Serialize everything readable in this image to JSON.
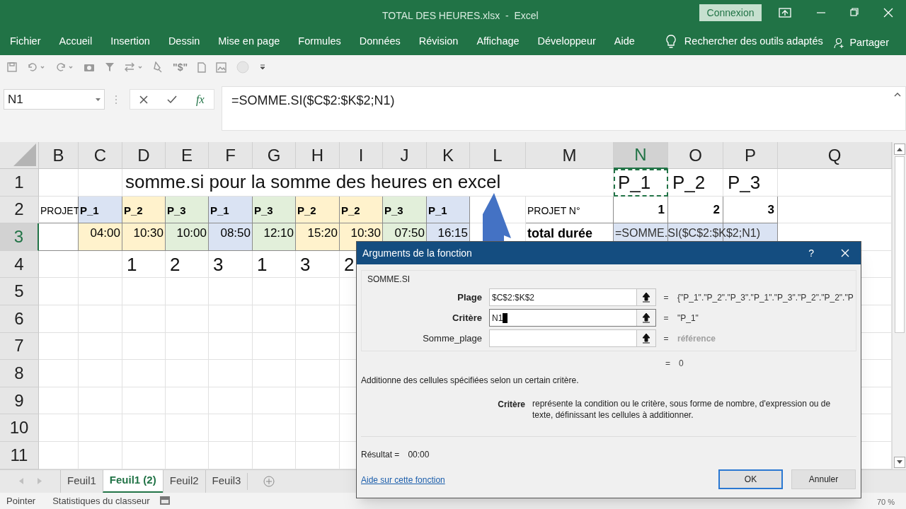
{
  "window": {
    "title": "TOTAL DES HEURES.xlsx  -  Excel",
    "account_button": "Connexion"
  },
  "ribbon_tabs": [
    "Fichier",
    "Accueil",
    "Insertion",
    "Dessin",
    "Mise en page",
    "Formules",
    "Données",
    "Révision",
    "Affichage",
    "Développeur",
    "Aide"
  ],
  "tell_me": "Rechercher des outils adaptés",
  "share": "Partager",
  "quick_access_text": "\"$\"",
  "formula_bar": {
    "name_box": "N1",
    "function_symbol": "fx",
    "formula": "=SOMME.SI($C$2:$K$2;N1)"
  },
  "sheet": {
    "columns": [
      {
        "label": "B",
        "selected": false
      },
      {
        "label": "C",
        "selected": false
      },
      {
        "label": "D",
        "selected": false
      },
      {
        "label": "E",
        "selected": false
      },
      {
        "label": "F",
        "selected": false
      },
      {
        "label": "G",
        "selected": false
      },
      {
        "label": "H",
        "selected": false
      },
      {
        "label": "I",
        "selected": false
      },
      {
        "label": "J",
        "selected": false
      },
      {
        "label": "K",
        "selected": false
      },
      {
        "label": "L",
        "selected": false
      },
      {
        "label": "M",
        "selected": false
      },
      {
        "label": "N",
        "selected": true
      },
      {
        "label": "O",
        "selected": false
      },
      {
        "label": "P",
        "selected": false
      },
      {
        "label": "Q",
        "selected": false
      }
    ],
    "rows": [
      {
        "label": "1",
        "selected": false,
        "cells": [
          {
            "kind": "empty"
          },
          {
            "kind": "empty"
          },
          {
            "kind": "title",
            "text": "somme.si pour la somme des heures en excel"
          },
          {
            "kind": "overflow"
          },
          {
            "kind": "overflow"
          },
          {
            "kind": "overflow"
          },
          {
            "kind": "overflow"
          },
          {
            "kind": "overflow"
          },
          {
            "kind": "overflow"
          },
          {
            "kind": "overflow"
          },
          {
            "kind": "overflow"
          },
          {
            "kind": "empty"
          },
          {
            "kind": "large",
            "text": "P_1",
            "marquee": true
          },
          {
            "kind": "large",
            "text": "P_2"
          },
          {
            "kind": "large",
            "text": "P_3"
          },
          {
            "kind": "empty"
          }
        ]
      },
      {
        "label": "2",
        "selected": false,
        "cells": [
          {
            "kind": "label",
            "text": "PROJET"
          },
          {
            "kind": "code",
            "text": "P_1",
            "color": "#dae3f3"
          },
          {
            "kind": "code",
            "text": "P_2",
            "color": "#fff2cc"
          },
          {
            "kind": "code",
            "text": "P_3",
            "color": "#e2efda"
          },
          {
            "kind": "code",
            "text": "P_1",
            "color": "#dae3f3"
          },
          {
            "kind": "code",
            "text": "P_3",
            "color": "#e2efda"
          },
          {
            "kind": "code",
            "text": "P_2",
            "color": "#fff2cc"
          },
          {
            "kind": "code",
            "text": "P_2",
            "color": "#fff2cc"
          },
          {
            "kind": "code",
            "text": "P_3",
            "color": "#e2efda"
          },
          {
            "kind": "code",
            "text": "P_1",
            "color": "#dae3f3"
          },
          {
            "kind": "empty"
          },
          {
            "kind": "label",
            "text": "PROJET N°"
          },
          {
            "kind": "value",
            "text": "1"
          },
          {
            "kind": "value",
            "text": "2"
          },
          {
            "kind": "value",
            "text": "3"
          },
          {
            "kind": "empty"
          }
        ]
      },
      {
        "label": "3",
        "selected": true,
        "cells": [
          {
            "kind": "boxed"
          },
          {
            "kind": "time",
            "text": "04:00",
            "color": "#fff2cc"
          },
          {
            "kind": "time",
            "text": "10:30",
            "color": "#fff2cc"
          },
          {
            "kind": "time",
            "text": "10:00",
            "color": "#e2efda"
          },
          {
            "kind": "time",
            "text": "08:50",
            "color": "#dae3f3"
          },
          {
            "kind": "time",
            "text": "12:10",
            "color": "#e2efda"
          },
          {
            "kind": "time",
            "text": "15:20",
            "color": "#fff2cc"
          },
          {
            "kind": "time",
            "text": "10:30",
            "color": "#fff2cc"
          },
          {
            "kind": "time",
            "text": "07:50",
            "color": "#e2efda"
          },
          {
            "kind": "time",
            "text": "16:15",
            "color": "#dae3f3"
          },
          {
            "kind": "empty"
          },
          {
            "kind": "strong",
            "text": "total durée"
          },
          {
            "kind": "formula",
            "text": "=SOMME.SI($C$2:$K$2;N1)",
            "color": "#dae3f3"
          },
          {
            "kind": "boxed",
            "color": "#dae3f3"
          },
          {
            "kind": "boxed",
            "color": "#dae3f3"
          },
          {
            "kind": "empty"
          }
        ]
      },
      {
        "label": "4",
        "selected": false,
        "cells": [
          {
            "kind": "empty"
          },
          {
            "kind": "empty"
          },
          {
            "kind": "large",
            "text": "1"
          },
          {
            "kind": "large",
            "text": "2"
          },
          {
            "kind": "large",
            "text": "3"
          },
          {
            "kind": "large",
            "text": "1"
          },
          {
            "kind": "large",
            "text": "3"
          },
          {
            "kind": "large",
            "text": "2"
          }
        ]
      },
      {
        "label": "5",
        "selected": false,
        "cells": []
      },
      {
        "label": "6",
        "selected": false,
        "cells": []
      },
      {
        "label": "7",
        "selected": false,
        "cells": []
      },
      {
        "label": "8",
        "selected": false,
        "cells": []
      },
      {
        "label": "9",
        "selected": false,
        "cells": []
      },
      {
        "label": "10",
        "selected": false,
        "cells": []
      },
      {
        "label": "11",
        "selected": false,
        "cells": []
      }
    ]
  },
  "sheet_tabs": [
    {
      "label": "Feuil1",
      "selected": false
    },
    {
      "label": "Feuil1 (2)",
      "selected": true
    },
    {
      "label": "Feuil2",
      "selected": false
    },
    {
      "label": "Feuil3",
      "selected": false
    }
  ],
  "status_bar": {
    "mode": "Pointer",
    "statistics": "Statistiques du classeur",
    "zoom": "70 %"
  },
  "dialog": {
    "title": "Arguments de la fonction",
    "help": "?",
    "function_name": "SOMME.SI",
    "arguments": [
      {
        "label": "Plage",
        "required": true,
        "value": "$C$2:$K$2",
        "focused": false,
        "equals": "=",
        "result": "{\"P_1\".\"P_2\".\"P_3\".\"P_1\".\"P_3\".\"P_2\".\"P_2\".\"P"
      },
      {
        "label": "Critère",
        "required": true,
        "value": "N1",
        "focused": true,
        "equals": "=",
        "result": "\"P_1\""
      },
      {
        "label": "Somme_plage",
        "required": false,
        "focused": false,
        "equals": "=",
        "result": "référence"
      }
    ],
    "total_equals": "=",
    "total_value": "0",
    "description": "Additionne des cellules spécifiées selon un certain critère.",
    "parameter_name": "Critère",
    "parameter_description": "représente la condition ou le critère, sous forme de nombre, d'expression ou de texte, définissant les cellules à additionner.",
    "result_label": "Résultat =",
    "result_value": "00:00",
    "help_link": "Aide sur cette fonction",
    "buttons": [
      {
        "label": "OK",
        "default": true
      },
      {
        "label": "Annuler",
        "default": false
      }
    ]
  }
}
